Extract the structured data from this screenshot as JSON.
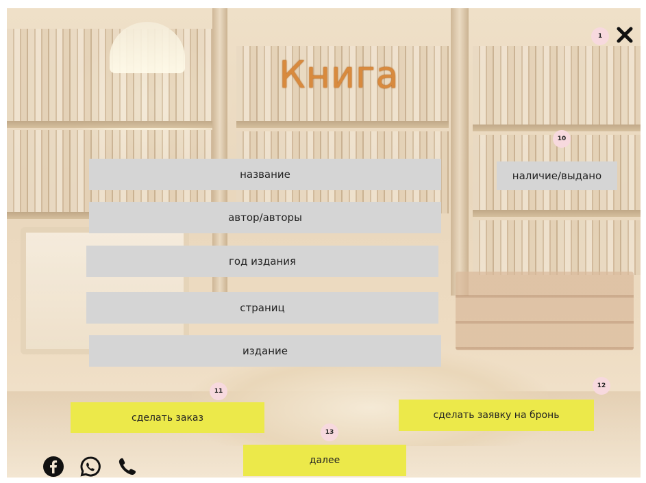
{
  "title": "Книга",
  "fields": {
    "name": "название",
    "author": "автор/авторы",
    "year": "год издания",
    "pages": "страниц",
    "edition": "издание"
  },
  "availability": "наличие/выдано",
  "buttons": {
    "order": "сделать заказ",
    "reserve": "сделать заявку на бронь",
    "next": "далее"
  },
  "markers": {
    "close": "1",
    "availability": "10",
    "order": "11",
    "reserve": "12",
    "next": "13"
  },
  "icons": {
    "close": "close-icon",
    "facebook": "facebook-icon",
    "whatsapp": "whatsapp-icon",
    "phone": "phone-icon"
  },
  "colors": {
    "title": "#d88a3e",
    "field_bg": "#d5d5d5",
    "button_bg": "#ece94a",
    "marker_bg": "#f7d9de"
  }
}
